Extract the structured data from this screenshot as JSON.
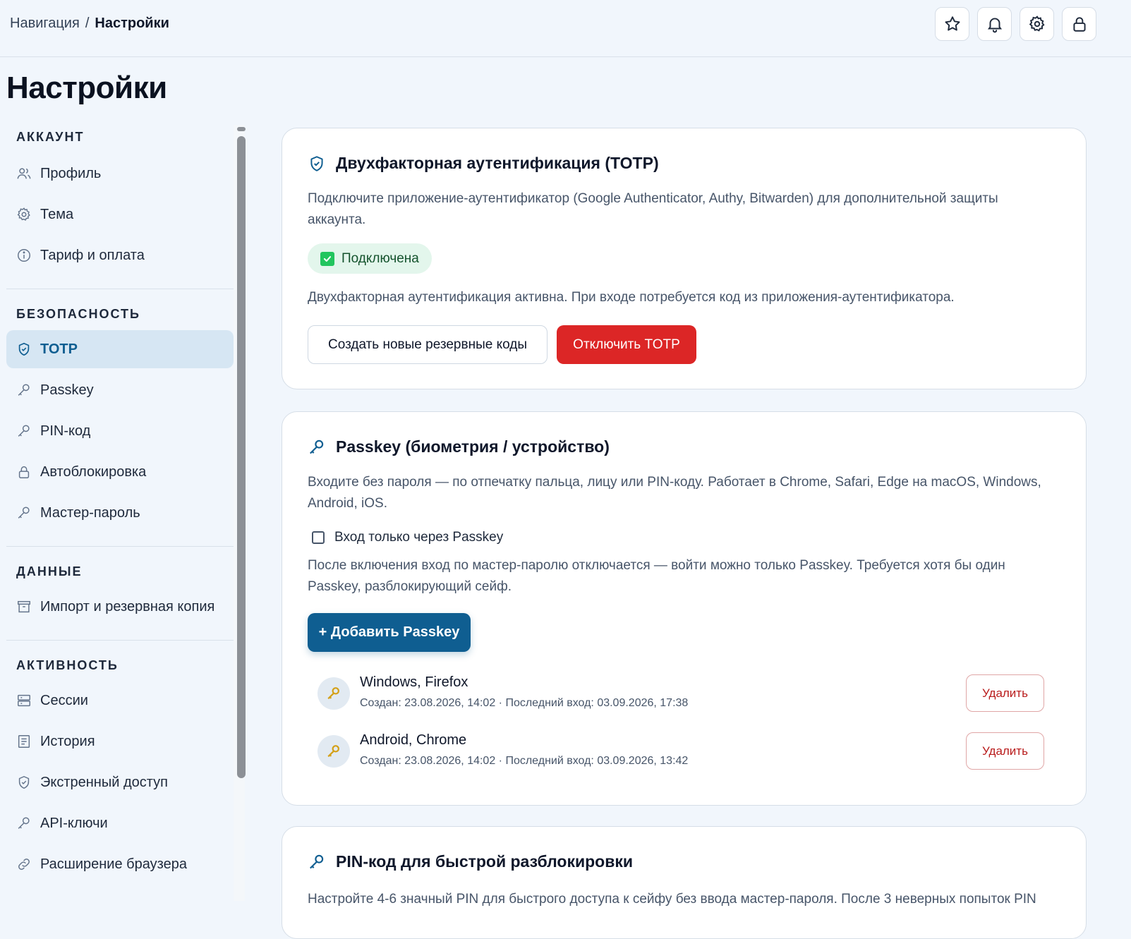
{
  "breadcrumb": {
    "root": "Навигация",
    "separator": "/",
    "current": "Настройки"
  },
  "top_icons": [
    "star-icon",
    "bell-icon",
    "gear-icon",
    "lock-icon"
  ],
  "page_title": "Настройки",
  "sidebar": {
    "sections": [
      {
        "title": "АККАУНТ",
        "items": [
          {
            "label": "Профиль",
            "icon": "users-icon"
          },
          {
            "label": "Тема",
            "icon": "gear-icon"
          },
          {
            "label": "Тариф и оплата",
            "icon": "info-icon"
          }
        ]
      },
      {
        "title": "БЕЗОПАСНОСТЬ",
        "items": [
          {
            "label": "TOTP",
            "icon": "shield-icon",
            "active": true
          },
          {
            "label": "Passkey",
            "icon": "key-icon"
          },
          {
            "label": "PIN-код",
            "icon": "key-icon"
          },
          {
            "label": "Автоблокировка",
            "icon": "lock-icon"
          },
          {
            "label": "Мастер-пароль",
            "icon": "key-icon"
          }
        ]
      },
      {
        "title": "ДАННЫЕ",
        "items": [
          {
            "label": "Импорт и резервная копия",
            "icon": "archive-icon"
          }
        ]
      },
      {
        "title": "АКТИВНОСТЬ",
        "items": [
          {
            "label": "Сессии",
            "icon": "server-icon"
          },
          {
            "label": "История",
            "icon": "list-icon"
          },
          {
            "label": "Экстренный доступ",
            "icon": "shield-icon"
          },
          {
            "label": "API-ключи",
            "icon": "key-icon"
          },
          {
            "label": "Расширение браузера",
            "icon": "link-icon"
          }
        ]
      }
    ]
  },
  "totp": {
    "title": "Двухфакторная аутентификация (TOTP)",
    "description": "Подключите приложение-аутентификатор (Google Authenticator, Authy, Bitwarden) для дополнительной защиты аккаунта.",
    "status": "Подключена",
    "status_text": "Двухфакторная аутентификация активна. При входе потребуется код из приложения-аутентификатора.",
    "backup_button": "Создать новые резервные коды",
    "disable_button": "Отключить TOTP"
  },
  "passkey": {
    "title": "Passkey (биометрия / устройство)",
    "description": "Входите без пароля — по отпечатку пальца, лицу или PIN-коду. Работает в Chrome, Safari, Edge на macOS, Windows, Android, iOS.",
    "only_passkey_label": "Вход только через Passkey",
    "only_passkey_checked": false,
    "only_passkey_hint": "После включения вход по мастер-паролю отключается — войти можно только Passkey. Требуется хотя бы один Passkey, разблокирующий сейф.",
    "add_button": "+ Добавить Passkey",
    "keys": [
      {
        "name": "Windows, Firefox",
        "meta": "Создан: 23.08.2026, 14:02 · Последний вход: 03.09.2026, 17:38",
        "delete_label": "Удалить"
      },
      {
        "name": "Android, Chrome",
        "meta": "Создан: 23.08.2026, 14:02 · Последний вход: 03.09.2026, 13:42",
        "delete_label": "Удалить"
      }
    ]
  },
  "pin": {
    "title": "PIN-код для быстрой разблокировки",
    "description": "Настройте 4-6 значный PIN для быстрого доступа к сейфу без ввода мастер-пароля. После 3 неверных попыток PIN"
  }
}
